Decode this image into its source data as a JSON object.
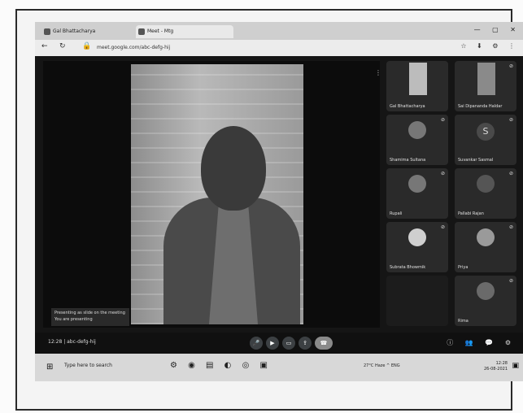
{
  "browser": {
    "tabs": [
      {
        "label": "Gal Bhattacharya"
      },
      {
        "label": "Meet - Mtg"
      }
    ],
    "url": "meet.google.com/abc-defg-hij",
    "win_controls": "— ▢ ✕",
    "extensions": "☆ ⬇ ⚙ ⋮"
  },
  "meeting": {
    "presenter_notice": "Presenting as slide on the meeting",
    "presenter_sub": "You are presenting",
    "participants": [
      {
        "name": "Gal Bhattacharya",
        "type": "photo"
      },
      {
        "name": "Sai Dipananda Haldar",
        "type": "photo"
      },
      {
        "name": "Shamima Sultana",
        "type": "avatar"
      },
      {
        "name": "Suvankar Sasmal",
        "type": "letter",
        "letter": "S"
      },
      {
        "name": "Rupali",
        "type": "avatar"
      },
      {
        "name": "Pallabi Rajan",
        "type": "avatar"
      },
      {
        "name": "Subrata Bhowmik",
        "type": "avatar"
      },
      {
        "name": "Priya",
        "type": "avatar"
      },
      {
        "name": "",
        "type": "dark"
      },
      {
        "name": "Rima",
        "type": "avatar"
      }
    ],
    "meeting_code": "12:28 | abc-defg-hij"
  },
  "taskbar": {
    "search_placeholder": "Type here to search",
    "tray_text": "27°C Haze  ^  ENG",
    "time": "12:28",
    "date": "26-08-2021"
  }
}
